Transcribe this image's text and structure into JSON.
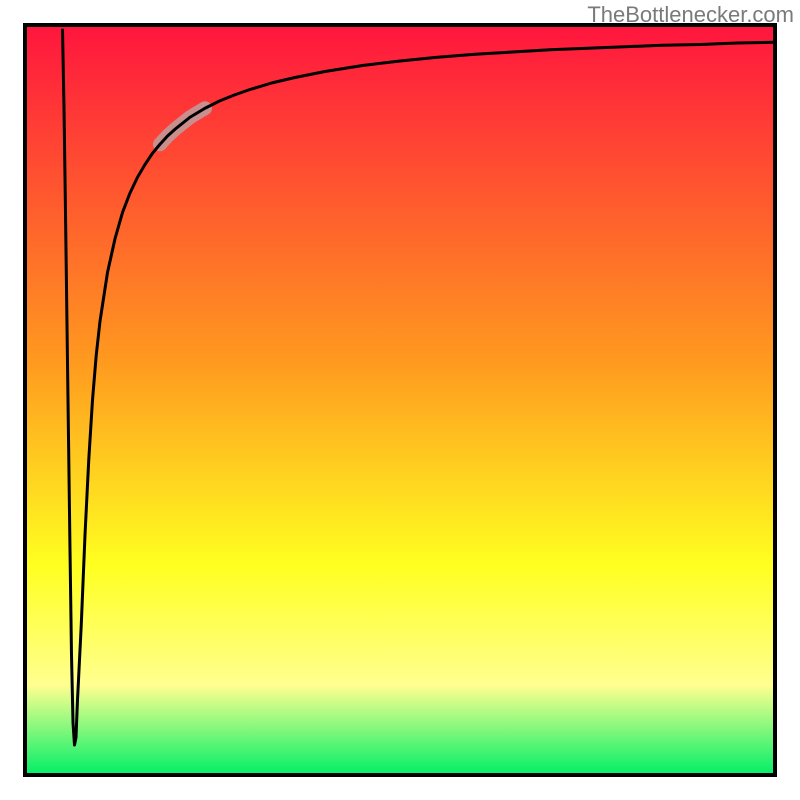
{
  "attribution": "TheBottlenecker.com",
  "colors": {
    "gradient_top": "#ff153e",
    "gradient_orange": "#ff9a1f",
    "gradient_yellow": "#ffff20",
    "gradient_green": "#00ef67",
    "curve": "#000000",
    "highlight": "#c98e8e",
    "frame": "#000000"
  },
  "chart_data": {
    "type": "line",
    "title": "",
    "xlabel": "",
    "ylabel": "",
    "xlim": [
      0,
      100
    ],
    "ylim": [
      0,
      100
    ],
    "x": [
      5,
      5.2,
      5.4,
      5.6,
      5.8,
      6,
      6.2,
      6.4,
      6.6,
      6.8,
      7,
      7.5,
      8,
      8.5,
      9,
      9.5,
      10,
      11,
      12,
      13,
      14,
      15,
      16,
      17,
      18,
      19,
      20,
      22,
      24,
      26,
      28,
      30,
      33,
      36,
      40,
      45,
      50,
      55,
      60,
      65,
      70,
      75,
      80,
      85,
      90,
      95,
      100
    ],
    "values": [
      99.5,
      89,
      75,
      60,
      45,
      30,
      16,
      7,
      4,
      5,
      10,
      20,
      32,
      42,
      50,
      56,
      60.5,
      67,
      71.5,
      75,
      77.6,
      79.7,
      81.4,
      82.9,
      84.1,
      85.2,
      86.1,
      87.7,
      88.9,
      89.9,
      90.7,
      91.4,
      92.3,
      93.0,
      93.8,
      94.6,
      95.2,
      95.7,
      96.1,
      96.4,
      96.7,
      96.9,
      97.1,
      97.3,
      97.4,
      97.6,
      97.7
    ],
    "highlight_segment": {
      "x_start": 18,
      "x_end": 24
    }
  }
}
